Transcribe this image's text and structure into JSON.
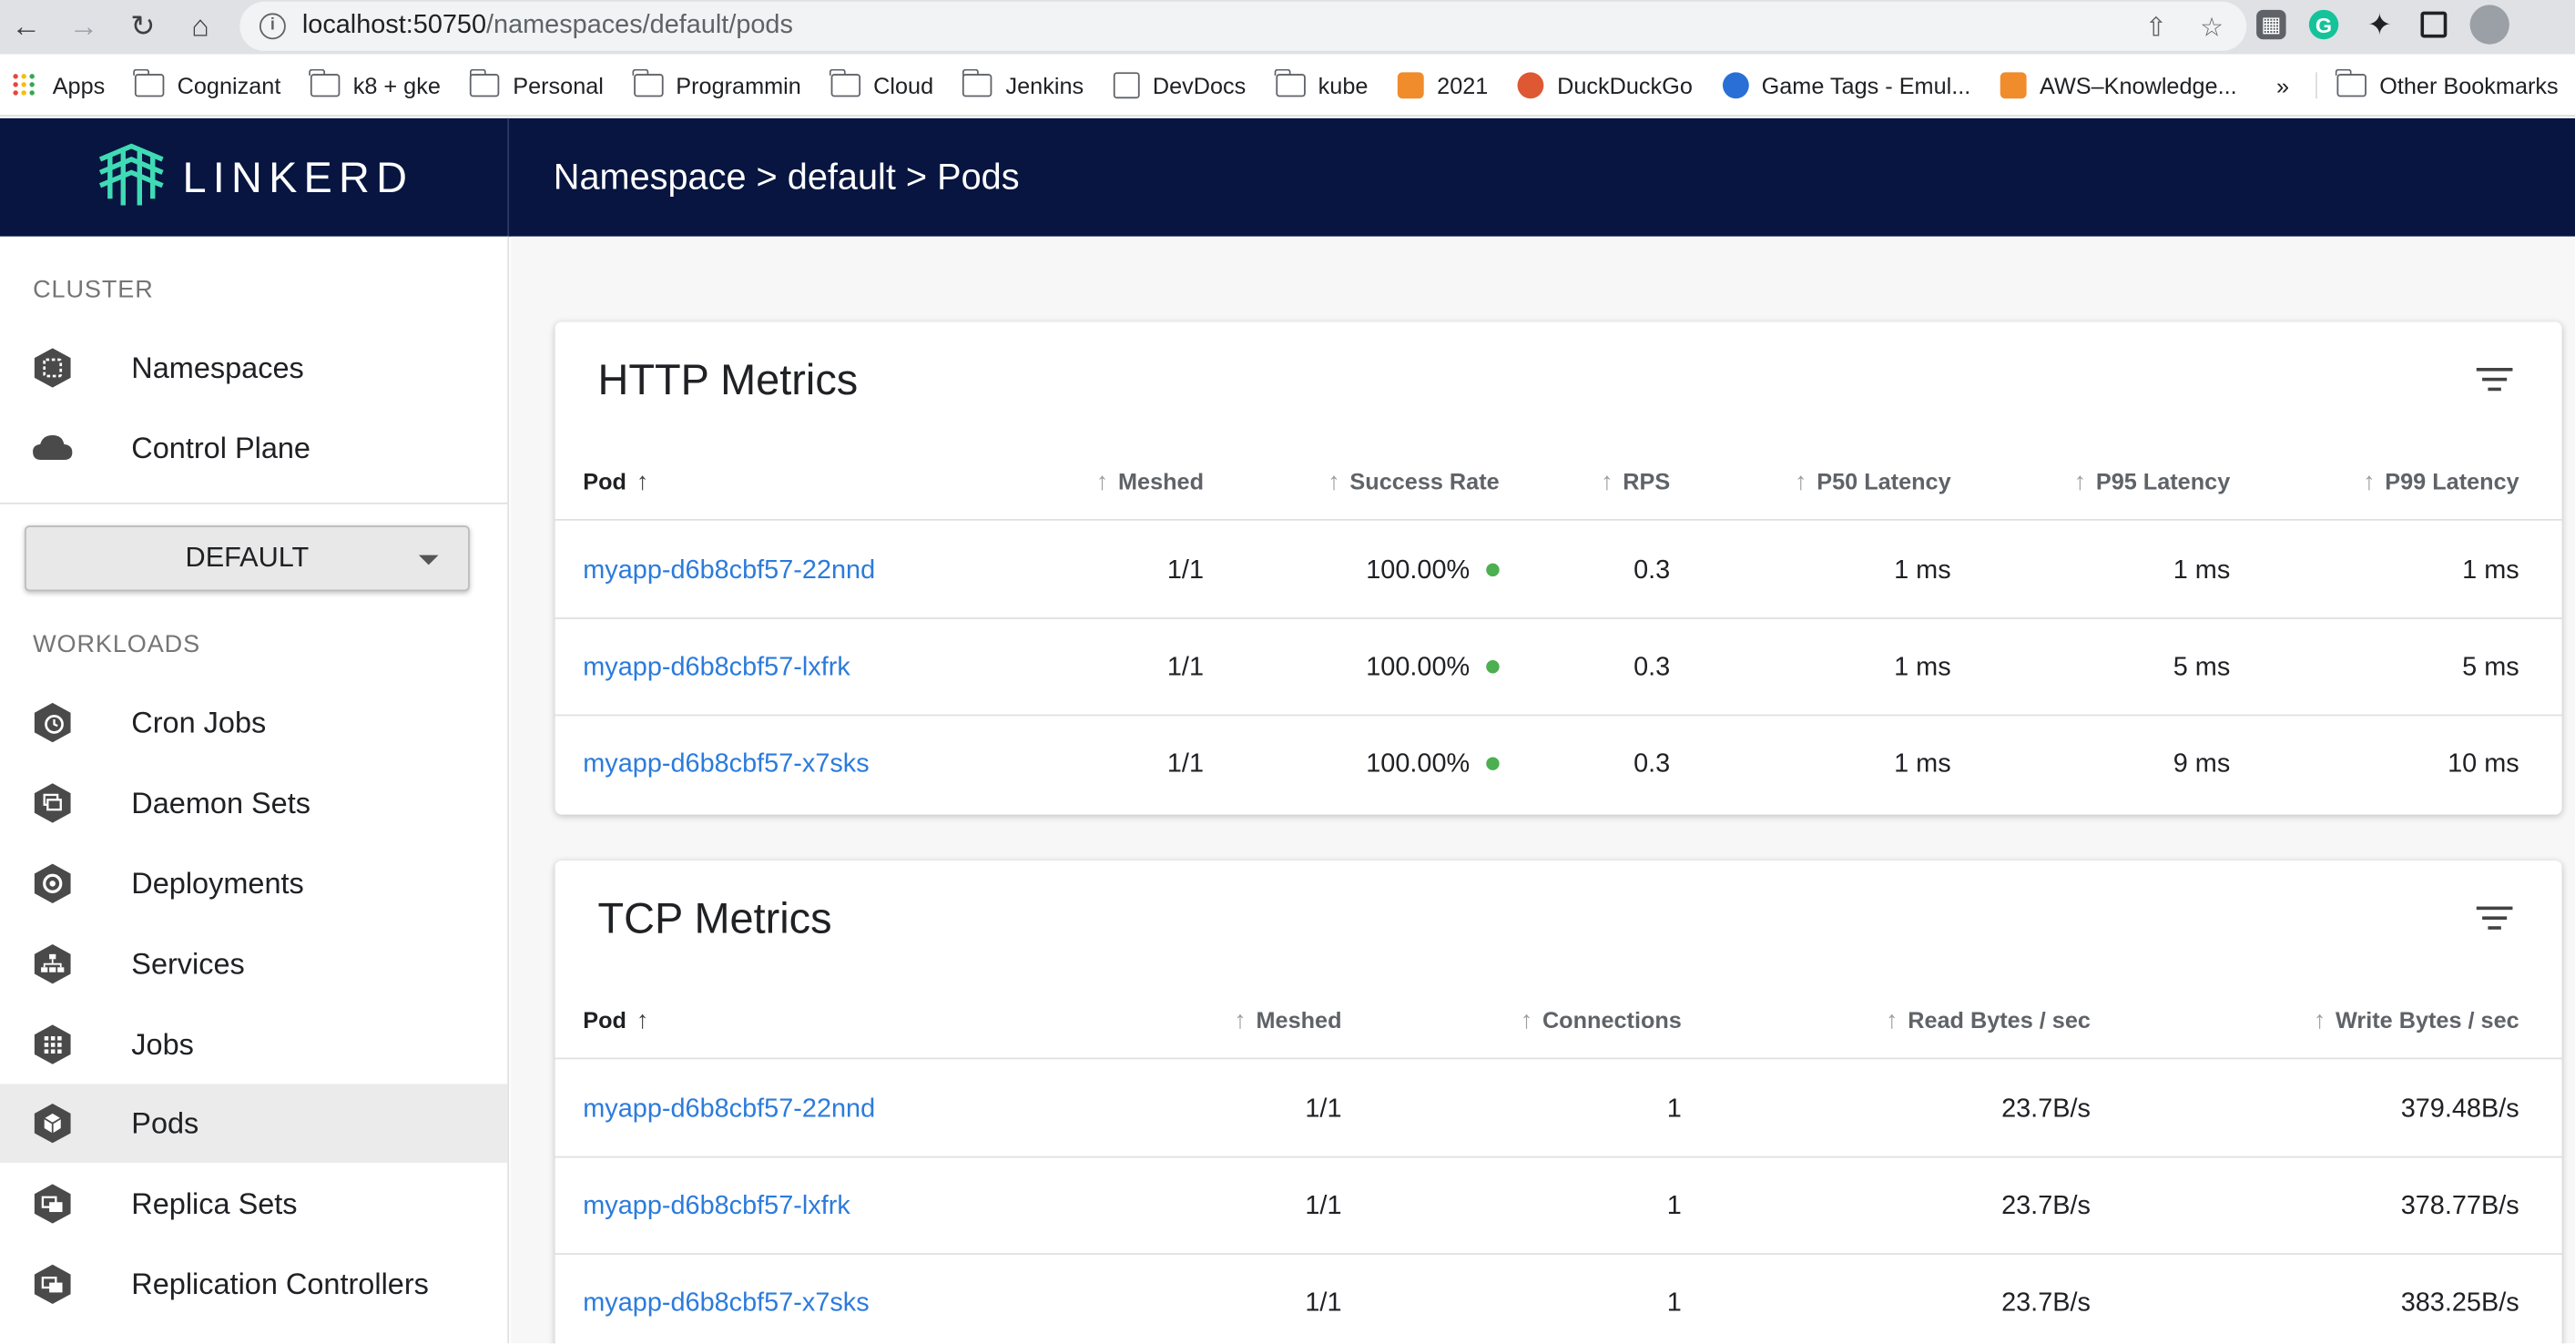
{
  "browser": {
    "url_host": "localhost:50750",
    "url_path": "/namespaces/default/pods",
    "bookmarks": [
      {
        "label": "Apps",
        "type": "apps"
      },
      {
        "label": "Cognizant",
        "type": "folder"
      },
      {
        "label": "k8 + gke",
        "type": "folder"
      },
      {
        "label": "Personal",
        "type": "folder"
      },
      {
        "label": "Programmin",
        "type": "folder"
      },
      {
        "label": "Cloud",
        "type": "folder"
      },
      {
        "label": "Jenkins",
        "type": "folder"
      },
      {
        "label": "DevDocs",
        "type": "site"
      },
      {
        "label": "kube",
        "type": "folder"
      },
      {
        "label": "2021",
        "type": "site"
      },
      {
        "label": "DuckDuckGo",
        "type": "site"
      },
      {
        "label": "Game Tags - Emul...",
        "type": "site"
      },
      {
        "label": "AWS–Knowledge...",
        "type": "site"
      }
    ],
    "more_label": "»",
    "other_bookmarks": "Other Bookmarks"
  },
  "header": {
    "logo_text": "LINKERD",
    "title": "Namespace > default > Pods"
  },
  "sidebar": {
    "cluster_label": "CLUSTER",
    "cluster_items": [
      {
        "label": "Namespaces",
        "icon": "namespace-icon"
      },
      {
        "label": "Control Plane",
        "icon": "cloud-icon"
      }
    ],
    "namespace_select": "DEFAULT",
    "workloads_label": "WORKLOADS",
    "workload_items": [
      {
        "label": "Cron Jobs",
        "icon": "cronjob-icon"
      },
      {
        "label": "Daemon Sets",
        "icon": "daemonset-icon"
      },
      {
        "label": "Deployments",
        "icon": "deployment-icon"
      },
      {
        "label": "Services",
        "icon": "service-icon"
      },
      {
        "label": "Jobs",
        "icon": "job-icon"
      },
      {
        "label": "Pods",
        "icon": "pod-icon",
        "active": true
      },
      {
        "label": "Replica Sets",
        "icon": "replicaset-icon"
      },
      {
        "label": "Replication Controllers",
        "icon": "replicationcontroller-icon"
      }
    ]
  },
  "http_metrics": {
    "title": "HTTP Metrics",
    "columns": [
      "Pod",
      "Meshed",
      "Success Rate",
      "RPS",
      "P50 Latency",
      "P95 Latency",
      "P99 Latency"
    ],
    "rows": [
      {
        "pod": "myapp-d6b8cbf57-22nnd",
        "meshed": "1/1",
        "success_rate": "100.00%",
        "rps": "0.3",
        "p50": "1 ms",
        "p95": "1 ms",
        "p99": "1 ms"
      },
      {
        "pod": "myapp-d6b8cbf57-lxfrk",
        "meshed": "1/1",
        "success_rate": "100.00%",
        "rps": "0.3",
        "p50": "1 ms",
        "p95": "5 ms",
        "p99": "5 ms"
      },
      {
        "pod": "myapp-d6b8cbf57-x7sks",
        "meshed": "1/1",
        "success_rate": "100.00%",
        "rps": "0.3",
        "p50": "1 ms",
        "p95": "9 ms",
        "p99": "10 ms"
      }
    ],
    "status_color": "#4caf50"
  },
  "tcp_metrics": {
    "title": "TCP Metrics",
    "columns": [
      "Pod",
      "Meshed",
      "Connections",
      "Read Bytes / sec",
      "Write Bytes / sec"
    ],
    "rows": [
      {
        "pod": "myapp-d6b8cbf57-22nnd",
        "meshed": "1/1",
        "connections": "1",
        "read": "23.7B/s",
        "write": "379.48B/s"
      },
      {
        "pod": "myapp-d6b8cbf57-lxfrk",
        "meshed": "1/1",
        "connections": "1",
        "read": "23.7B/s",
        "write": "378.77B/s"
      },
      {
        "pod": "myapp-d6b8cbf57-x7sks",
        "meshed": "1/1",
        "connections": "1",
        "read": "23.7B/s",
        "write": "383.25B/s"
      }
    ]
  },
  "colors": {
    "header_bg": "#071540",
    "link": "#2b7bdc",
    "active_nav": "#ebebeb"
  }
}
